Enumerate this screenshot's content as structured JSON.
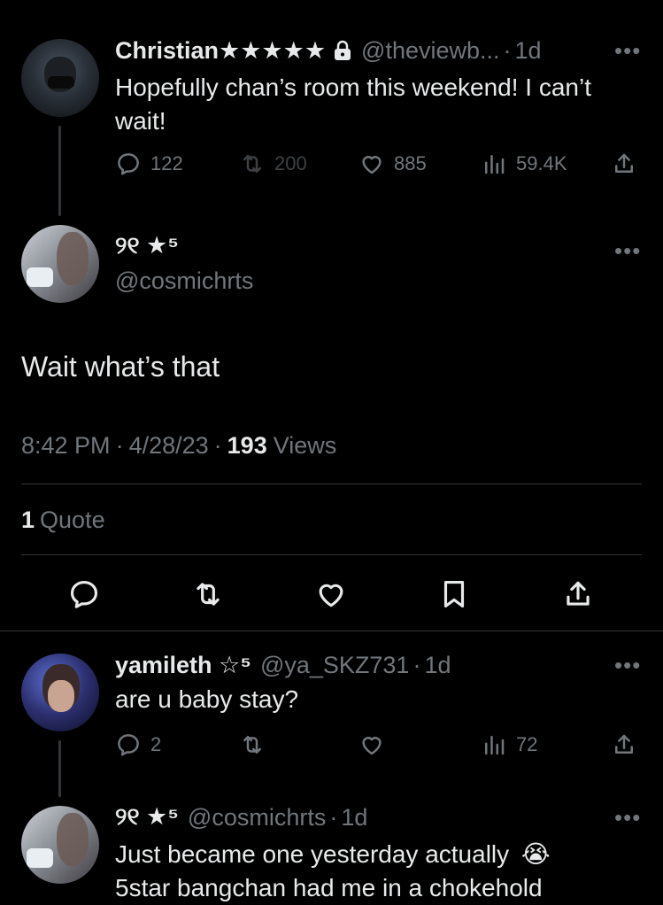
{
  "parent_tweet": {
    "author_name": "Christian★★★★★",
    "author_handle": "@theviewb...",
    "time": "1d",
    "text_line1": "Hopefully chan’s room this weekend! I can’t",
    "text_line2": "wait!",
    "replies": "122",
    "retweets": "200",
    "likes": "885",
    "views": "59.4K"
  },
  "main_tweet": {
    "author_name": "୨୧ ★⁵",
    "author_handle": "@cosmichrts",
    "text": "Wait what’s that",
    "time": "8:42 PM",
    "date": "4/28/23",
    "views_count": "193",
    "views_label": "Views",
    "quotes_count": "1",
    "quotes_label": "Quote"
  },
  "reply_1": {
    "author_name": "yamileth ☆⁵",
    "author_handle": "@ya_SKZ731",
    "time": "1d",
    "text": "are u baby stay?",
    "replies": "2",
    "views": "72"
  },
  "reply_2": {
    "author_name": "୨୧ ★⁵",
    "author_handle": "@cosmichrts",
    "time": "1d",
    "text_line1": "Just became one yesterday actually",
    "emoji": "😭",
    "text_line2": "5star bangchan had me in a chokehold"
  },
  "colors": {
    "background": "#000000",
    "text": "#e7e9ea",
    "muted": "#71767b",
    "divider": "#2f3336"
  }
}
